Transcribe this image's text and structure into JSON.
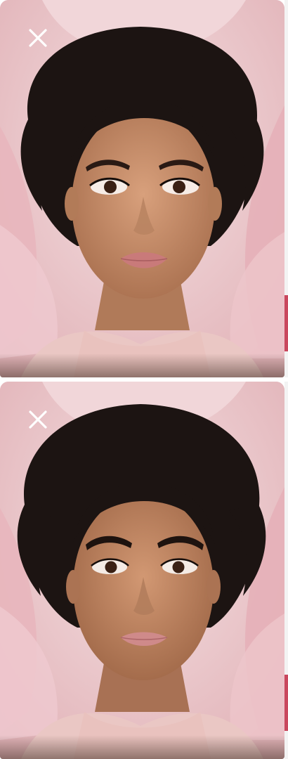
{
  "viewer": {
    "panels": [
      {
        "id": "panel-1",
        "close_icon": "close-icon",
        "image": "portrait-photo"
      },
      {
        "id": "panel-2",
        "close_icon": "close-icon",
        "image": "portrait-photo"
      }
    ]
  },
  "colors": {
    "background_pink": "#ecd0d3",
    "petal_pink": "#e8b9bf",
    "skin": "#c8906d",
    "hair": "#1c1412",
    "lips": "#c97a7a",
    "close_icon": "#ffffff",
    "edge_accent": "#c9475d"
  }
}
